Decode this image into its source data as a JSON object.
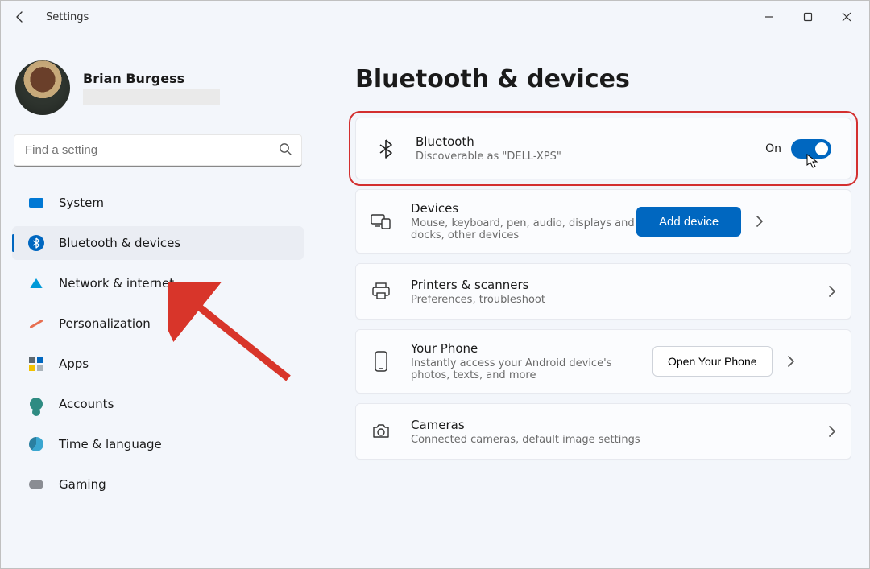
{
  "window": {
    "title": "Settings"
  },
  "profile": {
    "name": "Brian Burgess"
  },
  "search": {
    "placeholder": "Find a setting"
  },
  "nav": {
    "items": [
      {
        "label": "System"
      },
      {
        "label": "Bluetooth & devices"
      },
      {
        "label": "Network & internet"
      },
      {
        "label": "Personalization"
      },
      {
        "label": "Apps"
      },
      {
        "label": "Accounts"
      },
      {
        "label": "Time & language"
      },
      {
        "label": "Gaming"
      }
    ],
    "active_index": 1
  },
  "page": {
    "title": "Bluetooth & devices"
  },
  "bluetooth_card": {
    "title": "Bluetooth",
    "subtitle": "Discoverable as \"DELL-XPS\"",
    "state_label": "On"
  },
  "devices_card": {
    "title": "Devices",
    "subtitle": "Mouse, keyboard, pen, audio, displays and docks, other devices",
    "button": "Add device"
  },
  "printers_card": {
    "title": "Printers & scanners",
    "subtitle": "Preferences, troubleshoot"
  },
  "phone_card": {
    "title": "Your Phone",
    "subtitle": "Instantly access your Android device's photos, texts, and more",
    "button": "Open Your Phone"
  },
  "cameras_card": {
    "title": "Cameras",
    "subtitle": "Connected cameras, default image settings"
  }
}
